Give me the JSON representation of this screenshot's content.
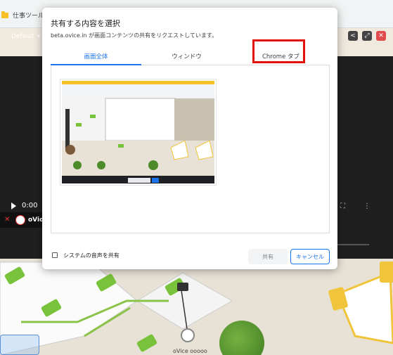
{
  "bookmark_bar": {
    "folder_label": "仕事ツール"
  },
  "video": {
    "layout_label": "Default",
    "time": "0:00",
    "user_name": "oVic"
  },
  "floor": {
    "user_label": "oVice ooooo"
  },
  "dialog": {
    "title": "共有する内容を選択",
    "subtitle": "beta.ovice.in が画面コンテンツの共有をリクエストしています。",
    "tabs": [
      {
        "label": "画面全体",
        "active": true
      },
      {
        "label": "ウィンドウ",
        "active": false
      },
      {
        "label": "Chrome タブ",
        "active": false
      }
    ],
    "share_audio_label": "システムの音声を共有",
    "share_button": "共有",
    "cancel_button": "キャンセル"
  },
  "colors": {
    "accent": "#1a73e8",
    "highlight": "#e0120c"
  }
}
